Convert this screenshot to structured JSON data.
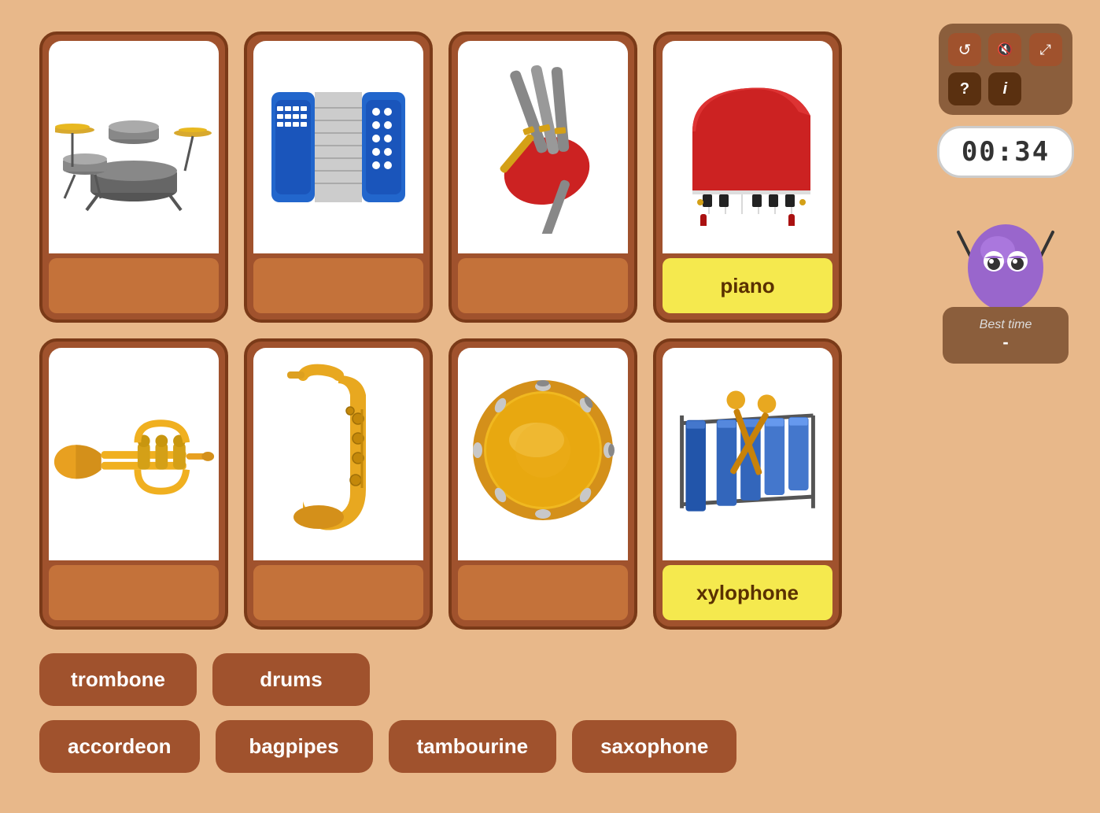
{
  "cards": [
    {
      "id": "drums",
      "label": "",
      "label_filled": false,
      "instrument": "drums"
    },
    {
      "id": "accordion",
      "label": "",
      "label_filled": false,
      "instrument": "accordion"
    },
    {
      "id": "bagpipes",
      "label": "",
      "label_filled": false,
      "instrument": "bagpipes"
    },
    {
      "id": "piano",
      "label": "piano",
      "label_filled": true,
      "instrument": "piano"
    },
    {
      "id": "trumpet",
      "label": "",
      "label_filled": false,
      "instrument": "trumpet"
    },
    {
      "id": "saxophone",
      "label": "",
      "label_filled": false,
      "instrument": "saxophone"
    },
    {
      "id": "tambourine",
      "label": "",
      "label_filled": false,
      "instrument": "tambourine"
    },
    {
      "id": "xylophone",
      "label": "xylophone",
      "label_filled": true,
      "instrument": "xylophone"
    }
  ],
  "word_buttons_row1": [
    {
      "id": "trombone",
      "label": "trombone"
    },
    {
      "id": "drums-btn",
      "label": "drums"
    }
  ],
  "word_buttons_row2": [
    {
      "id": "accordeon-btn",
      "label": "accordeon"
    },
    {
      "id": "bagpipes-btn",
      "label": "bagpipes"
    },
    {
      "id": "tambourine-btn",
      "label": "tambourine"
    },
    {
      "id": "saxophone-btn",
      "label": "saxophone"
    }
  ],
  "timer": {
    "display": "00:34"
  },
  "best_time": {
    "label": "Best time",
    "value": "-"
  },
  "controls": {
    "reset_icon": "↺",
    "mute_icon": "🔇",
    "expand_icon": "⊞",
    "help_icon": "?",
    "info_icon": "i"
  }
}
